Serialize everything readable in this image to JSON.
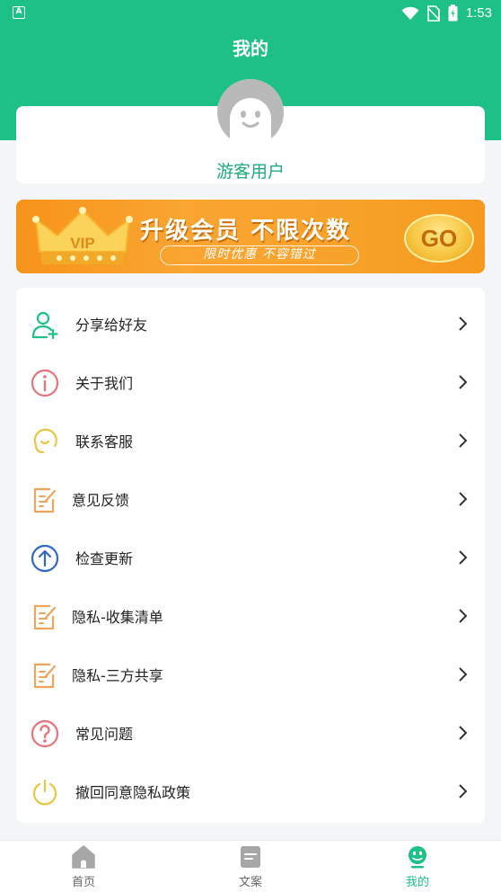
{
  "status_bar": {
    "time": "1:53",
    "notification_letter": "A"
  },
  "header": {
    "title": "我的"
  },
  "profile": {
    "username": "游客用户"
  },
  "vip_banner": {
    "crown_text": "VIP",
    "title": "升级会员 不限次数",
    "subtitle": "限时优惠  不容错过",
    "go_label": "GO"
  },
  "menu": {
    "items": [
      {
        "label": "分享给好友",
        "icon": "add-user-icon",
        "color": "#1dc186"
      },
      {
        "label": "关于我们",
        "icon": "info-icon",
        "color": "#e8737a"
      },
      {
        "label": "联系客服",
        "icon": "customer-service-icon",
        "color": "#e9c640"
      },
      {
        "label": "意见反馈",
        "icon": "feedback-icon",
        "color": "#f0a35a"
      },
      {
        "label": "检查更新",
        "icon": "update-icon",
        "color": "#2f68c4"
      },
      {
        "label": "隐私-收集清单",
        "icon": "privacy-list-icon",
        "color": "#f0a35a"
      },
      {
        "label": "隐私-三方共享",
        "icon": "privacy-share-icon",
        "color": "#f0a35a"
      },
      {
        "label": "常见问题",
        "icon": "question-icon",
        "color": "#e8737a"
      },
      {
        "label": "撤回同意隐私政策",
        "icon": "power-icon",
        "color": "#e9c640"
      }
    ]
  },
  "tabs": [
    {
      "label": "首页",
      "icon": "home-icon",
      "active": false
    },
    {
      "label": "文案",
      "icon": "document-icon",
      "active": false
    },
    {
      "label": "我的",
      "icon": "profile-face-icon",
      "active": true
    }
  ],
  "colors": {
    "primary": "#1dc186",
    "username": "#1dac7a",
    "inactive_tab": "#666666"
  }
}
